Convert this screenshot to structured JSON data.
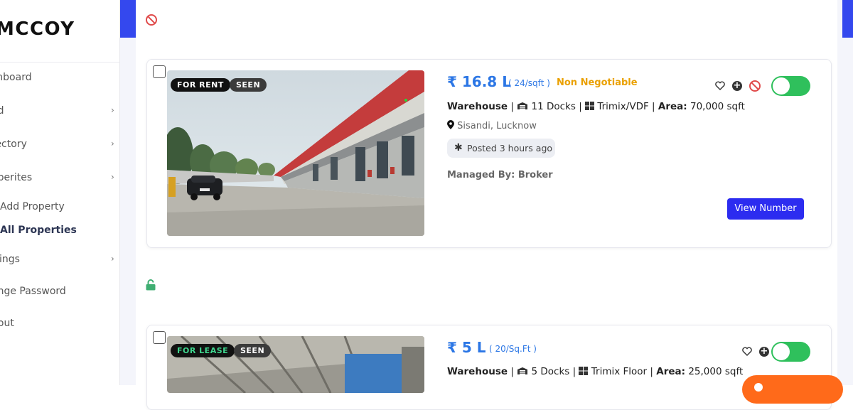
{
  "sidebar": {
    "logo": "MCCOY",
    "items": [
      {
        "label": "shboard"
      },
      {
        "label": "ad"
      },
      {
        "label": "rectory"
      },
      {
        "label": "operites"
      },
      {
        "label": "Add Property"
      },
      {
        "label": "All Properties"
      },
      {
        "label": "ttings"
      },
      {
        "label": "ange Password"
      },
      {
        "label": "gout"
      }
    ],
    "chevron": "›"
  },
  "listings": [
    {
      "tags": {
        "type": "FOR RENT",
        "seen": "SEEN"
      },
      "price": "₹ 16.8 L",
      "rate": "( 24/sqft )",
      "negotiable": "Non Negotiable",
      "category": "Warehouse",
      "docks": "11 Docks",
      "floor": "Trimix/VDF",
      "area_label": "Area:",
      "area": "70,000 sqft",
      "location": "Sisandi, Lucknow",
      "posted": "Posted 3 hours ago",
      "managed_label": "Managed By:",
      "managed_by": "Broker",
      "view_number": "View Number",
      "toggle_on": true
    },
    {
      "tags": {
        "type": "FOR LEASE",
        "seen": "SEEN"
      },
      "price": "₹ 5 L",
      "rate": "( 20/Sq.Ft )",
      "category": "Warehouse",
      "docks": "5 Docks",
      "floor": "Trimix Floor",
      "area_label": "Area:",
      "area": "25,000 sqft",
      "toggle_on": true
    }
  ],
  "colors": {
    "accent_blue": "#3448ee",
    "price_blue": "#2b76e5",
    "negotiable": "#eaa000",
    "toggle_on": "#2fc05c",
    "ban_red": "#e04b4b",
    "unlock_green": "#3fae72",
    "button_blue": "#2c2cf0",
    "fab_orange": "#ff6a1a"
  },
  "icons": [
    "ban-icon",
    "unlock-icon",
    "heart-icon",
    "plus-circle-icon",
    "map-pin-icon",
    "asterisk-icon",
    "warehouse-dock-icon",
    "floor-grid-icon",
    "chevron-right-icon"
  ]
}
